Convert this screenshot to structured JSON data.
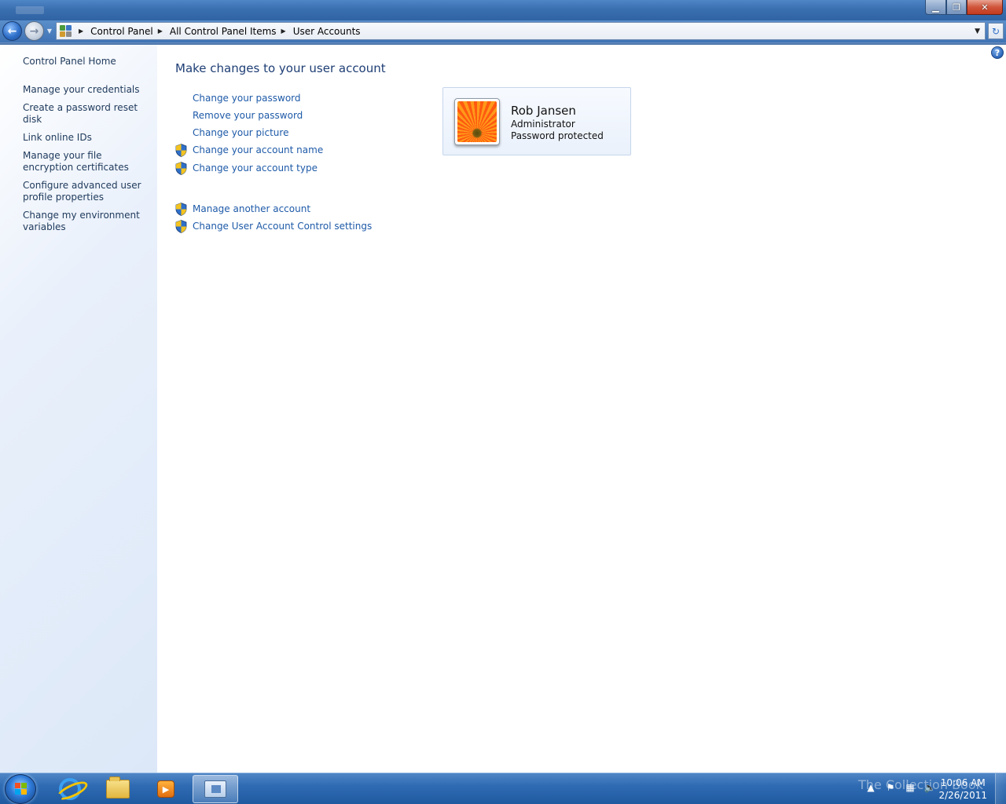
{
  "window": {
    "min_glyph": "▁",
    "max_glyph": "❐",
    "close_glyph": "✕"
  },
  "nav": {
    "back_glyph": "←",
    "forward_glyph": "→",
    "recent_glyph": "▼",
    "breadcrumb": [
      "Control Panel",
      "All Control Panel Items",
      "User Accounts"
    ],
    "crumb_separator": "▶",
    "dropdown_glyph": "▼",
    "refresh_glyph": "↻"
  },
  "sidebar": {
    "home": "Control Panel Home",
    "items": [
      "Manage your credentials",
      "Create a password reset disk",
      "Link online IDs",
      "Manage your file encryption certificates",
      "Configure advanced user profile properties",
      "Change my environment variables"
    ]
  },
  "main": {
    "title": "Make changes to your user account",
    "help_glyph": "?",
    "tasks": [
      {
        "label": "Change your password",
        "shield": false
      },
      {
        "label": "Remove your password",
        "shield": false
      },
      {
        "label": "Change your picture",
        "shield": false
      },
      {
        "label": "Change your account name",
        "shield": true
      },
      {
        "label": "Change your account type",
        "shield": true
      }
    ],
    "other_tasks": [
      {
        "label": "Manage another account",
        "shield": true
      },
      {
        "label": "Change User Account Control settings",
        "shield": true
      }
    ]
  },
  "account": {
    "name": "Rob Jansen",
    "role": "Administrator",
    "status": "Password protected"
  },
  "taskbar": {
    "watermark": "The Collection Book",
    "clock_time": "10:06 AM",
    "clock_date": "2/26/2011",
    "media_glyph": "▶"
  },
  "colors": {
    "link": "#1e5aa8",
    "title": "#1e3e75",
    "sidebar_text": "#1e395b"
  },
  "icons": [
    "back-arrow-icon",
    "forward-arrow-icon",
    "control-panel-icon",
    "refresh-icon",
    "help-icon",
    "uac-shield-icon",
    "windows-start-icon",
    "internet-explorer-icon",
    "windows-explorer-icon",
    "media-player-icon",
    "control-panel-taskbar-icon",
    "action-center-flag-icon",
    "network-icon",
    "volume-icon"
  ]
}
